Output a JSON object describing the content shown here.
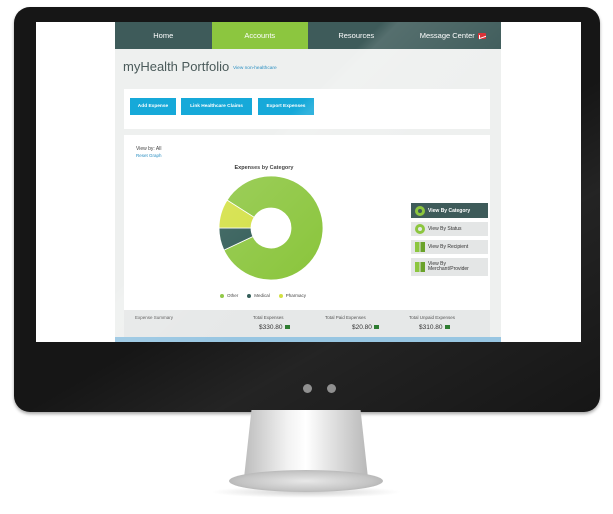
{
  "nav": {
    "items": [
      "Home",
      "Accounts",
      "Resources",
      "Message Center"
    ],
    "active": "Accounts"
  },
  "page": {
    "title": "myHealth Portfolio",
    "link": "View non-healthcare"
  },
  "actions": {
    "add_expense": "Add Expense",
    "link_claims": "Link Healthcare Claims",
    "export": "Export Expenses"
  },
  "view_by": "View by: All",
  "reset_graph": "Reset Graph",
  "chart_title": "Expenses by Category",
  "view_buttons": [
    "View By Category",
    "View By Status",
    "View By Recipient",
    "View By Merchant/Provider"
  ],
  "summary": {
    "label": "Expense Summary",
    "total_label": "Total Expenses",
    "total_value": "$330.80",
    "paid_label": "Total Paid Expenses",
    "paid_value": "$20.80",
    "unpaid_label": "Total Unpaid Expenses",
    "unpaid_value": "$310.80"
  },
  "colors": {
    "nav_bg": "#3e5b5a",
    "accent_green": "#8cc63f",
    "button_blue": "#16a9d9",
    "medical": "#2f5a55",
    "pharmacy": "#d3e043"
  },
  "chart_data": {
    "type": "pie",
    "title": "Expenses by Category",
    "labels": [
      "Other",
      "Medical",
      "Pharmacy"
    ],
    "values": [
      84,
      7,
      9
    ],
    "colors": [
      "#8cc63f",
      "#2f5a55",
      "#d3e043"
    ],
    "legend_position": "bottom"
  }
}
